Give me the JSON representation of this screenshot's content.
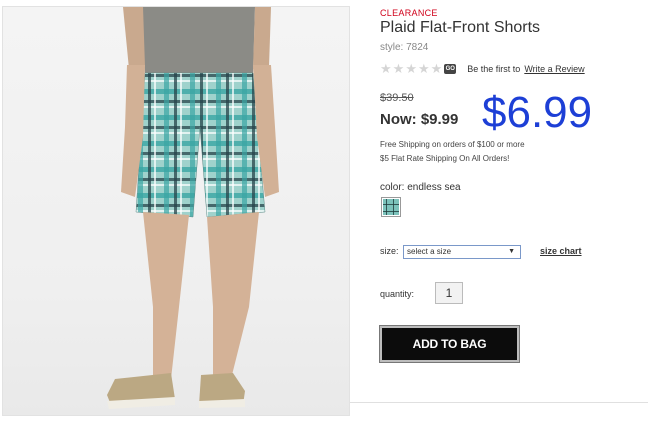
{
  "product": {
    "tag": "CLEARANCE",
    "title": "Plaid Flat-Front Shorts",
    "style": "style: 7824",
    "rating": {
      "stars_filled": 0,
      "stars_total": 5,
      "badge": "GO",
      "first_text": "Be the first to",
      "write_link": "Write a Review"
    },
    "price": {
      "was": "$39.50",
      "now": "Now: $9.99",
      "overlay": "$6.99"
    },
    "shipping": {
      "line1": "Free Shipping on orders of $100 or more",
      "line2": "$5 Flat Rate Shipping On All Orders!"
    },
    "color": {
      "label": "color: endless sea"
    },
    "size": {
      "label": "size:",
      "selected": "select a size",
      "chart_link": "size chart"
    },
    "quantity": {
      "label": "quantity:",
      "value": "1"
    },
    "add_button": "ADD TO BAG"
  },
  "colors": {
    "clearance": "#d0021b",
    "overlay_price": "#1d3fd6",
    "button_bg": "#0c0c0c",
    "plaid_base": "#7cc2bb"
  },
  "icons": {
    "star": "star-icon",
    "review_badge": "review-badge-icon",
    "dropdown": "chevron-down-icon"
  }
}
